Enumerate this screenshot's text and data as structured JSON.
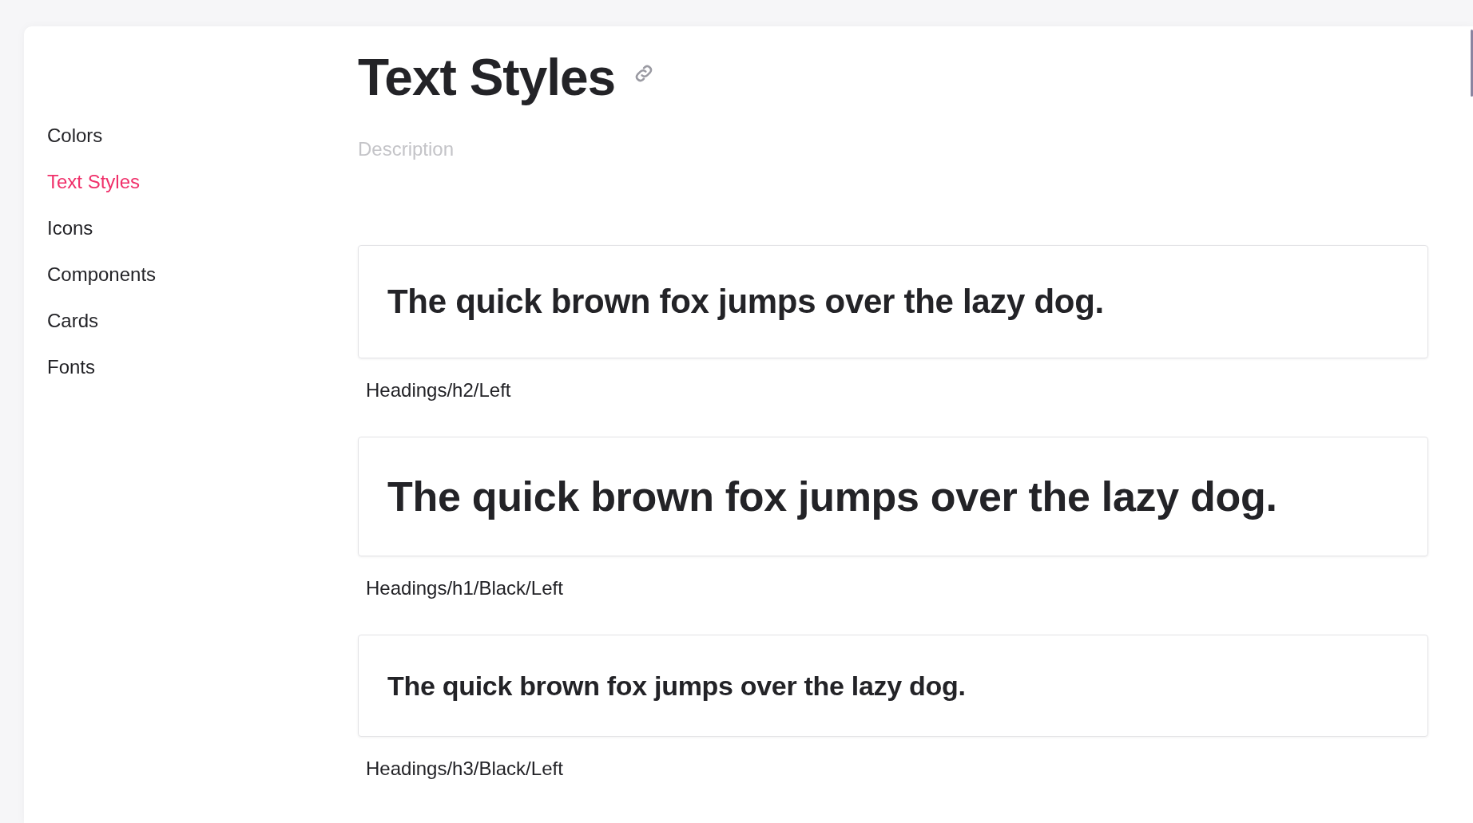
{
  "sidebar": {
    "items": [
      {
        "label": "Colors",
        "selected": false
      },
      {
        "label": "Text Styles",
        "selected": true
      },
      {
        "label": "Icons",
        "selected": false
      },
      {
        "label": "Components",
        "selected": false
      },
      {
        "label": "Cards",
        "selected": false
      },
      {
        "label": "Fonts",
        "selected": false
      }
    ]
  },
  "page": {
    "title": "Text Styles",
    "description": {
      "placeholder": "Description"
    }
  },
  "styles": [
    {
      "kind": "h2",
      "sample": "The quick brown fox jumps over the lazy dog.",
      "label": "Headings/h2/Left"
    },
    {
      "kind": "h1",
      "sample": "The quick brown fox jumps over the lazy dog.",
      "label": "Headings/h1/Black/Left"
    },
    {
      "kind": "h3",
      "sample": "The quick brown fox jumps over the lazy dog.",
      "label": "Headings/h3/Black/Left"
    }
  ]
}
